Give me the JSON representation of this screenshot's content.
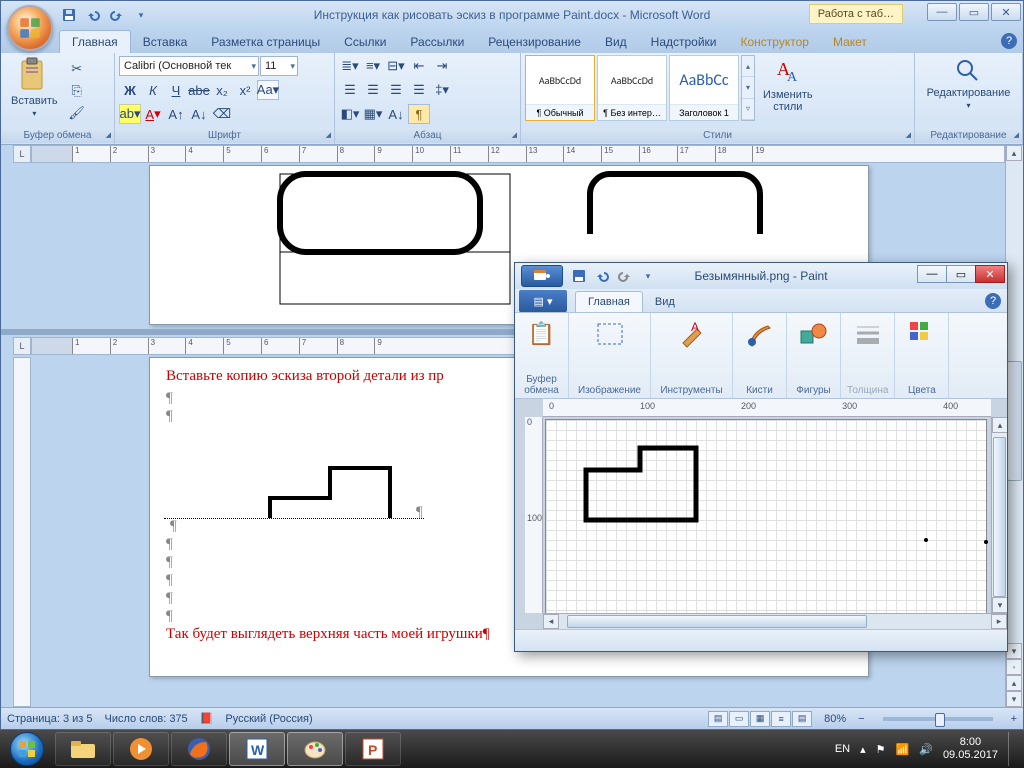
{
  "word": {
    "title": "Инструкция как рисовать эскиз в программе  Paint.docx - Microsoft Word",
    "context_tab": "Работа с таб…",
    "tabs": [
      "Главная",
      "Вставка",
      "Разметка страницы",
      "Ссылки",
      "Рассылки",
      "Рецензирование",
      "Вид",
      "Надстройки",
      "Конструктор",
      "Макет"
    ],
    "active_tab": 0,
    "groups": {
      "clipboard": "Буфер обмена",
      "font": "Шрифт",
      "paragraph": "Абзац",
      "styles": "Стили",
      "editing": "Редактирование"
    },
    "paste": "Вставить",
    "font_name": "Calibri (Основной тек",
    "font_size": "11",
    "style_items": [
      {
        "preview": "AaBbCcDd",
        "name": "¶ Обычный",
        "color": "#000",
        "size": "13px"
      },
      {
        "preview": "AaBbCcDd",
        "name": "¶ Без интер…",
        "color": "#000",
        "size": "13px"
      },
      {
        "preview": "AaBbCc",
        "name": "Заголовок 1",
        "color": "#2a5fab",
        "size": "16px"
      }
    ],
    "change_styles": "Изменить\nстили",
    "status": {
      "page": "Страница: 3 из 5",
      "words": "Число слов: 375",
      "lang": "Русский (Россия)",
      "zoom": "80%"
    },
    "doc": {
      "line1": "Вставьте копию эскиза второй детали из пр",
      "line2": "Так будет выглядеть верхняя часть моей игрушки¶"
    }
  },
  "paint": {
    "title": "Безымянный.png - Paint",
    "tabs": [
      "Главная",
      "Вид"
    ],
    "active_tab": 0,
    "menu": "▤ ▾",
    "groups": {
      "clipboard": "Буфер\nобмена",
      "image": "Изображение",
      "tools": "Инструменты",
      "brushes": "Кисти",
      "shapes": "Фигуры",
      "size": "Толщина",
      "colors": "Цвета"
    }
  },
  "taskbar": {
    "lang": "EN",
    "time": "8:00",
    "date": "09.05.2017"
  }
}
